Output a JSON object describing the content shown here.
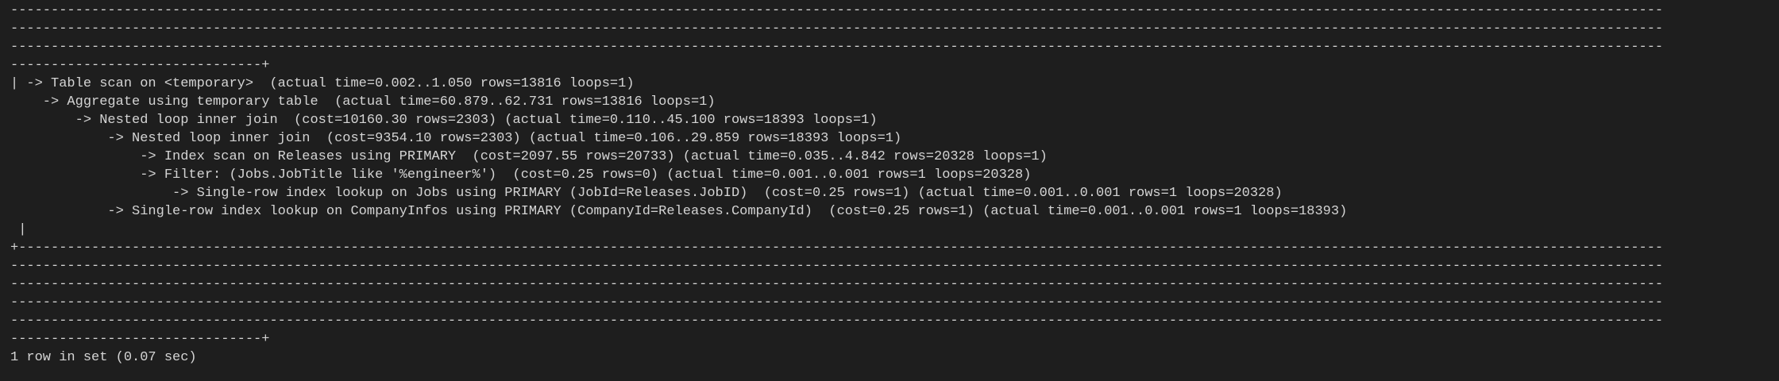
{
  "terminal": {
    "lines": [
      "------------------------------------------------------------------------------------------------------------------------------------------------------------------------------------------------------------",
      "------------------------------------------------------------------------------------------------------------------------------------------------------------------------------------------------------------",
      "------------------------------------------------------------------------------------------------------------------------------------------------------------------------------------------------------------",
      "-------------------------------+",
      "| -> Table scan on <temporary>  (actual time=0.002..1.050 rows=13816 loops=1)",
      "    -> Aggregate using temporary table  (actual time=60.879..62.731 rows=13816 loops=1)",
      "        -> Nested loop inner join  (cost=10160.30 rows=2303) (actual time=0.110..45.100 rows=18393 loops=1)",
      "            -> Nested loop inner join  (cost=9354.10 rows=2303) (actual time=0.106..29.859 rows=18393 loops=1)",
      "                -> Index scan on Releases using PRIMARY  (cost=2097.55 rows=20733) (actual time=0.035..4.842 rows=20328 loops=1)",
      "                -> Filter: (Jobs.JobTitle like '%engineer%')  (cost=0.25 rows=0) (actual time=0.001..0.001 rows=1 loops=20328)",
      "                    -> Single-row index lookup on Jobs using PRIMARY (JobId=Releases.JobID)  (cost=0.25 rows=1) (actual time=0.001..0.001 rows=1 loops=20328)",
      "            -> Single-row index lookup on CompanyInfos using PRIMARY (CompanyId=Releases.CompanyId)  (cost=0.25 rows=1) (actual time=0.001..0.001 rows=1 loops=18393)",
      " |",
      "+-----------------------------------------------------------------------------------------------------------------------------------------------------------------------------------------------------------",
      "------------------------------------------------------------------------------------------------------------------------------------------------------------------------------------------------------------",
      "------------------------------------------------------------------------------------------------------------------------------------------------------------------------------------------------------------",
      "------------------------------------------------------------------------------------------------------------------------------------------------------------------------------------------------------------",
      "------------------------------------------------------------------------------------------------------------------------------------------------------------------------------------------------------------",
      "-------------------------------+",
      "1 row in set (0.07 sec)"
    ]
  },
  "colors": {
    "background": "#1e1e1e",
    "text": "#d4d4d4"
  }
}
